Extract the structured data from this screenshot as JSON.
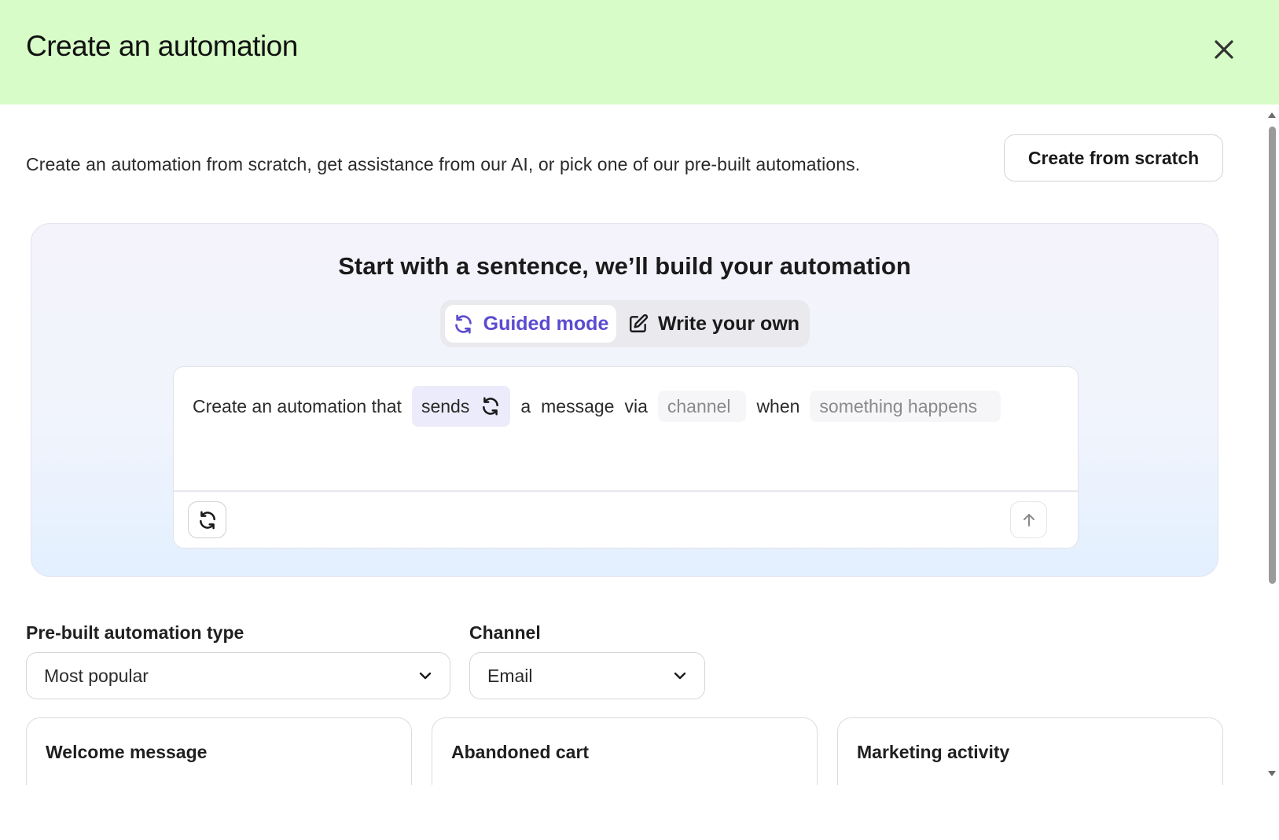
{
  "header": {
    "title": "Create an automation",
    "close_icon": "close-icon",
    "background_color": "#d7fcc7"
  },
  "intro": {
    "text": "Create an automation from scratch, get assistance from our AI, or pick one of our pre-built automations.",
    "create_from_scratch_label": "Create from scratch"
  },
  "ai_builder": {
    "title": "Start with a sentence, we’ll build your automation",
    "modes": {
      "guided_label": "Guided mode",
      "guided_icon": "refresh-icon",
      "write_label": "Write your own",
      "write_icon": "edit-icon",
      "selected": "Guided mode"
    },
    "sentence": {
      "prefix": "Create an automation that",
      "action_value": "sends",
      "word_a": "a",
      "word_message": "message",
      "word_via": "via",
      "channel_placeholder": "channel",
      "word_when": "when",
      "trigger_placeholder": "something happens"
    },
    "refresh_icon": "refresh-icon",
    "submit_icon": "arrow-up-icon",
    "accent_color": "#5b4bcf"
  },
  "filters": {
    "type_label": "Pre-built automation type",
    "type_value": "Most popular",
    "channel_label": "Channel",
    "channel_value": "Email",
    "dropdown_icon": "chevron-down-icon"
  },
  "templates": [
    {
      "title": "Welcome message"
    },
    {
      "title": "Abandoned cart"
    },
    {
      "title": "Marketing activity"
    }
  ]
}
